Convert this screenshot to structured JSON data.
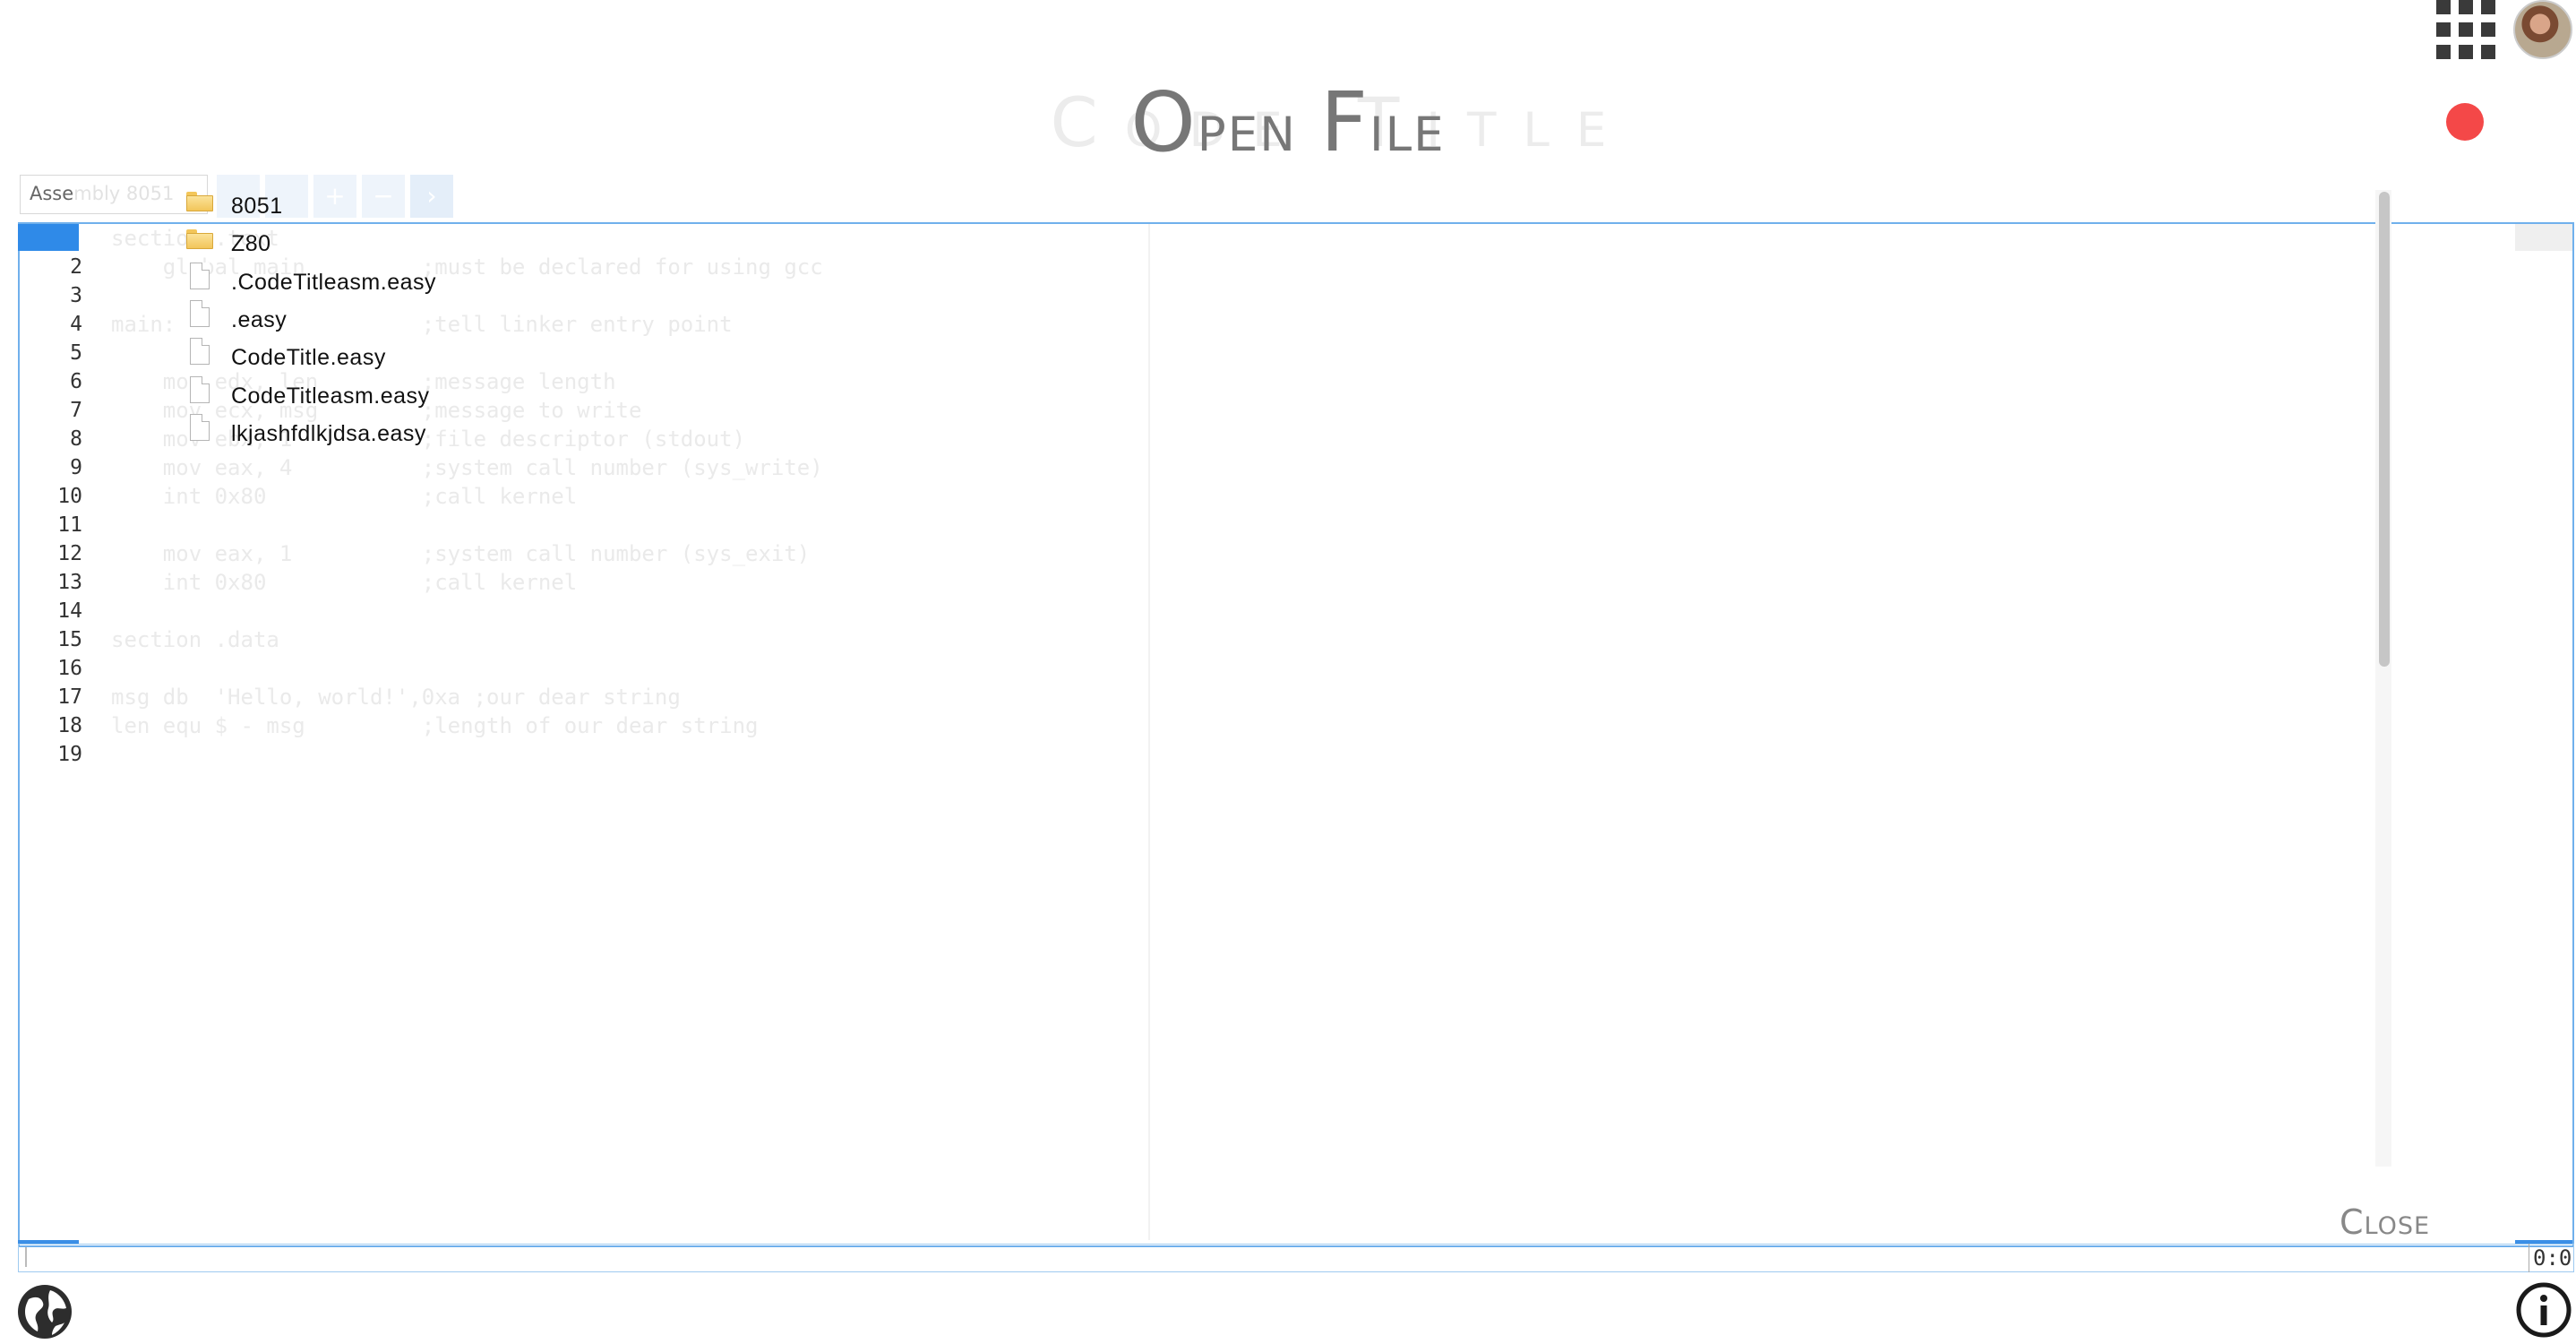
{
  "title": {
    "first": "O",
    "first_rest": "pen",
    "second": "F",
    "second_rest": "ile",
    "ghost": "Code Title"
  },
  "toolbar": {
    "language": "Assembly 8051",
    "language_visible": "Asse",
    "language_faded": "mbly 8051"
  },
  "file_list": [
    {
      "type": "folder",
      "name": "8051"
    },
    {
      "type": "folder",
      "name": "Z80"
    },
    {
      "type": "file",
      "name": ".CodeTitleasm.easy"
    },
    {
      "type": "file",
      "name": ".easy"
    },
    {
      "type": "file",
      "name": "CodeTitle.easy"
    },
    {
      "type": "file",
      "name": "CodeTitleasm.easy"
    },
    {
      "type": "file",
      "name": "lkjashfdlkjdsa.easy"
    }
  ],
  "editor": {
    "line_numbers": [
      "2",
      "3",
      "4",
      "5",
      "6",
      "7",
      "8",
      "9",
      "10",
      "11",
      "12",
      "13",
      "14",
      "15",
      "16",
      "17",
      "18",
      "19"
    ],
    "code": [
      "section .text",
      "    global main         ;must be declared for using gcc",
      "",
      "main:                   ;tell linker entry point",
      "",
      "    mov edx, len        ;message length",
      "    mov ecx, msg        ;message to write",
      "    mov ebx, 1          ;file descriptor (stdout)",
      "    mov eax, 4          ;system call number (sys_write)",
      "    int 0x80            ;call kernel",
      "",
      "    mov eax, 1          ;system call number (sys_exit)",
      "    int 0x80            ;call kernel",
      "",
      "section .data",
      "",
      "msg db  'Hello, world!',0xa ;our dear string",
      "len equ $ - msg         ;length of our dear string",
      ""
    ],
    "cursor_position": "0:0"
  },
  "dialog": {
    "close_label": "Close"
  },
  "icons": {
    "apps": "apps-grid-icon",
    "avatar": "user-avatar",
    "record": "record-indicator",
    "globe": "globe-icon",
    "info": "info-icon"
  },
  "colors": {
    "accent": "#3b8fe6",
    "record": "#f44848",
    "title": "#777777"
  }
}
